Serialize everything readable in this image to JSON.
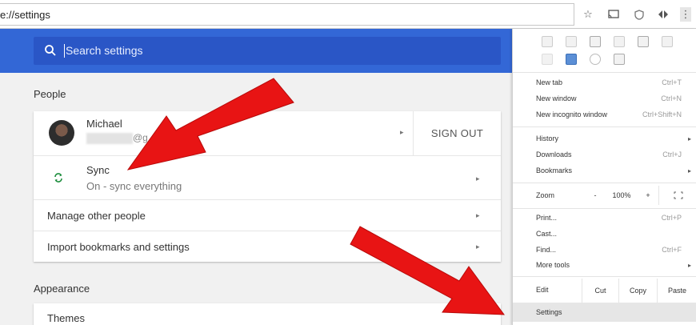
{
  "address_bar": {
    "url": "e://settings",
    "icons": [
      "star-icon",
      "cast-icon",
      "shield-icon",
      "extension-icon",
      "menu-icon"
    ]
  },
  "search": {
    "placeholder": "Search settings"
  },
  "people": {
    "title": "People",
    "account": {
      "name": "Michael",
      "email_visible": "@g",
      "sign_out": "SIGN OUT"
    },
    "sync": {
      "title": "Sync",
      "status": "On - sync everything"
    },
    "manage": "Manage other people",
    "import": "Import bookmarks and settings"
  },
  "appearance": {
    "title": "Appearance",
    "themes": "Themes"
  },
  "menu": {
    "new_tab": {
      "label": "New tab",
      "shortcut": "Ctrl+T"
    },
    "new_window": {
      "label": "New window",
      "shortcut": "Ctrl+N"
    },
    "incognito": {
      "label": "New incognito window",
      "shortcut": "Ctrl+Shift+N"
    },
    "history": {
      "label": "History"
    },
    "downloads": {
      "label": "Downloads",
      "shortcut": "Ctrl+J"
    },
    "bookmarks": {
      "label": "Bookmarks"
    },
    "zoom": {
      "label": "Zoom",
      "minus": "-",
      "value": "100%",
      "plus": "+"
    },
    "print": {
      "label": "Print...",
      "shortcut": "Ctrl+P"
    },
    "cast": {
      "label": "Cast..."
    },
    "find": {
      "label": "Find...",
      "shortcut": "Ctrl+F"
    },
    "more_tools": {
      "label": "More tools"
    },
    "edit": {
      "label": "Edit",
      "cut": "Cut",
      "copy": "Copy",
      "paste": "Paste"
    },
    "settings": {
      "label": "Settings"
    }
  },
  "colors": {
    "header_blue": "#3367d6",
    "search_blue": "#2a56c6",
    "arrow_red": "#e81414",
    "sync_green": "#1e8e3e"
  }
}
